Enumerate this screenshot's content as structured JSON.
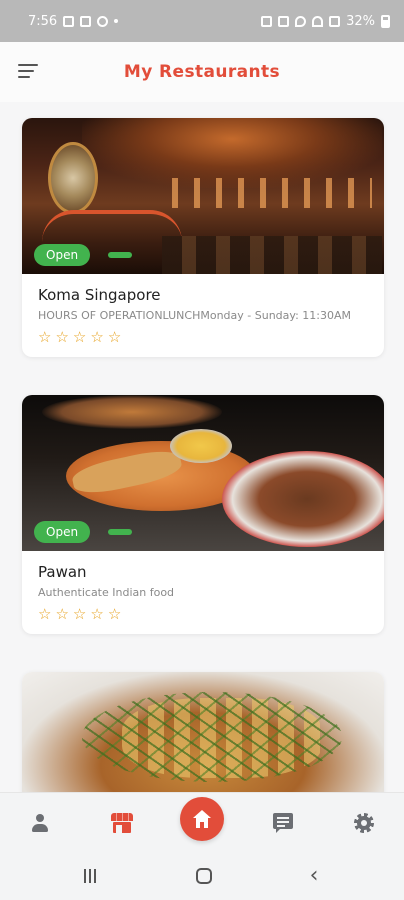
{
  "status_bar": {
    "time": "7:56",
    "battery": "32%"
  },
  "header": {
    "title": "My Restaurants"
  },
  "restaurants": [
    {
      "name": "Koma Singapore",
      "description": "HOURS OF OPERATIONLUNCHMonday - Sunday: 11:30AM",
      "status": "Open",
      "rating": 0,
      "star_symbol": "☆"
    },
    {
      "name": "Pawan",
      "description": "Authenticate Indian food",
      "status": "Open",
      "rating": 0,
      "star_symbol": "☆"
    }
  ],
  "bottom_nav": {
    "items": [
      {
        "icon": "user-icon"
      },
      {
        "icon": "store-icon",
        "active": true
      },
      {
        "icon": "home-icon"
      },
      {
        "icon": "chat-icon"
      },
      {
        "icon": "settings-icon"
      }
    ]
  },
  "system_nav": {
    "back_glyph": "‹"
  },
  "colors": {
    "accent": "#e24d3a",
    "open_badge": "#42b34e",
    "star": "#e7a21f"
  }
}
